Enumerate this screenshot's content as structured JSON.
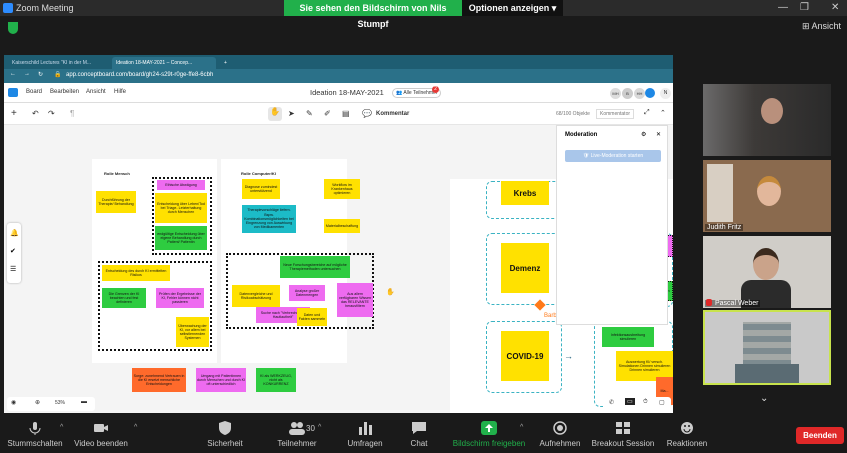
{
  "zoom": {
    "window_title": "Zoom Meeting",
    "share_banner": "Sie sehen den Bildschirm von Nils Stumpf",
    "view_options": "Optionen anzeigen",
    "view_button": "Ansicht",
    "end_button": "Beenden",
    "toolbar": [
      {
        "label": "Stummschalten",
        "icon": "microphone-icon"
      },
      {
        "label": "Video beenden",
        "icon": "video-camera-icon"
      },
      {
        "label": "Sicherheit",
        "icon": "shield-icon"
      },
      {
        "label": "Teilnehmer",
        "icon": "participants-icon",
        "count": "30"
      },
      {
        "label": "Umfragen",
        "icon": "poll-icon"
      },
      {
        "label": "Chat",
        "icon": "chat-icon"
      },
      {
        "label": "Bildschirm freigeben",
        "icon": "share-screen-icon"
      },
      {
        "label": "Aufnehmen",
        "icon": "record-icon"
      },
      {
        "label": "Breakout Session",
        "icon": "breakout-icon"
      },
      {
        "label": "Reaktionen",
        "icon": "reaction-icon"
      }
    ],
    "participants": [
      {
        "name": ""
      },
      {
        "name": "Judith Fritz"
      },
      {
        "name": "Pascal Weber"
      },
      {
        "name": ""
      }
    ],
    "colors": {
      "green": "#21b04b",
      "blue": "#2d8cff",
      "end": "#e02828"
    }
  },
  "browser": {
    "tabs": [
      "Kaiserschild Lectures \"KI in der M...",
      "Ideation 18-MAY-2021 – Concep..."
    ],
    "url": "app.conceptboard.com/board/gh24-s29t-r0ge-ffe8-6cbh"
  },
  "board": {
    "menu": [
      "Board",
      "Bearbeiten",
      "Ansicht",
      "Hilfe"
    ],
    "title": "Ideation 18-MAY-2021",
    "all_participants": "Alle Teilnehmer",
    "participant_badge": "2",
    "avatars": [
      "MH",
      "B",
      "HH",
      "N"
    ],
    "comment_tool": "Kommentar",
    "objects_count": "68/100 Objekte",
    "comment_mode": "Kommentator",
    "zoom_level": "53%",
    "human_role": "Rolle Mensch",
    "computer_role": "Rolle Computer/KI",
    "notes_left": [
      "Durchführung der Therapie/ Behandlung",
      "Ethische Abwägung",
      "Entscheidung über Leben/Tod bei Triage- Letzterhaltung durch Menschen",
      "endgültige Entscheidung über eigene Behandlung durch Patient/ Patientin",
      "Entscheidung des durch KI ermittelten Risikos",
      "Die Grenzen der KI beachten und fest definieren",
      "Prüfen der Ergebnisse der KI, Fehler können nicht passieren",
      "Überwachung der KI, vor allem bei selbstlernenden Systemen"
    ],
    "notes_right": [
      "Diagnose zumindest unterstützend",
      "Workflow im Krankenhaus optimieren",
      "Therapievorschläge liefern. Bspw. Kombinationsmöglichkeiten bei Eingrenzung von Auswirkung von Medikamenten",
      "Materialbeschaffung",
      "Neue Forschungsbereiche auf mögliche Therapiemethoden untersuchen",
      "Datenvergleiche und Risikoabschätzung",
      "Analyse großer Datenmengen",
      "Aus allem verfügbaren Wissen das RELEVANTE herausfiltern",
      "Suche nach \"Verbrechen im Hautlautheit\"",
      "Daten und Fakten sammeln"
    ],
    "notes_bottom": [
      "Sorge: zunehmend Vertrauen in die KI ersetzt menschliche Entscheidungen",
      "Umgang mit Patientinnen durch Menschen und durch KI oft unterschiedlich",
      "KI als WERKZEUG, nicht als KONKURRENZ"
    ],
    "topics": [
      "Krebs",
      "Demenz",
      "COVID-19"
    ],
    "cursor_user": "Barbara",
    "side_notes": [
      "Videos bzgl. Diagnose/ Beratung diagnostizierte Personen",
      "Frühintervention bei Krebsarten",
      "Infektionsausbreitung simulieren",
      "Auswertung KI/ versch. Simulationen Drinnen simulieren Drinnen simulieren",
      "Ma..."
    ],
    "moderation": {
      "title": "Moderation",
      "start_button": "Live-Moderation starten"
    },
    "colors": {
      "yellow": "#ffe100",
      "green": "#2ecc40",
      "pink": "#ee6bf0",
      "orange": "#ff6a2b",
      "cyan": "#1cbbc7",
      "dash": "#3bb3c3"
    }
  }
}
